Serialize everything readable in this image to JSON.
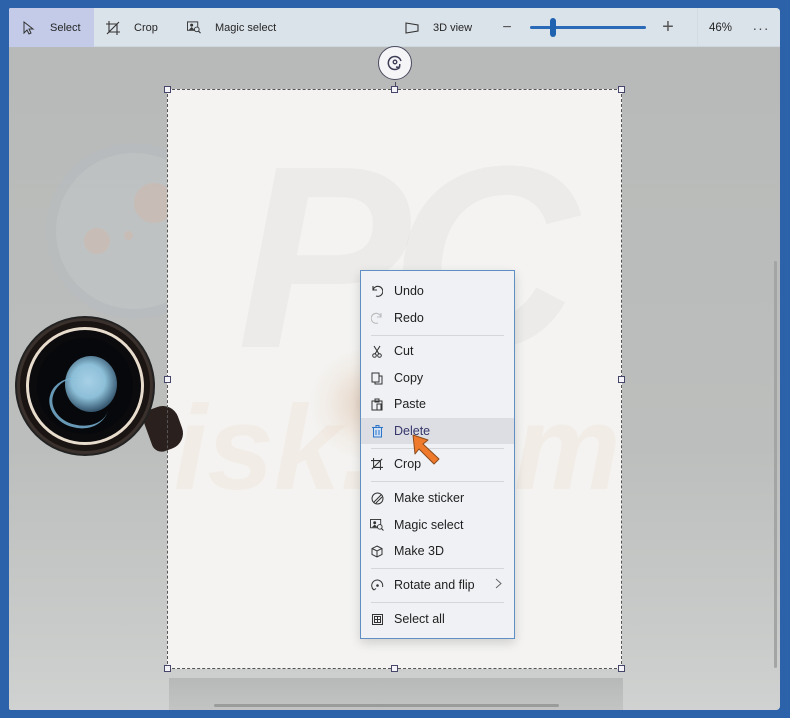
{
  "toolbar": {
    "select_label": "Select",
    "crop_label": "Crop",
    "magic_select_label": "Magic select",
    "view3d_label": "3D view",
    "zoom_out_label": "−",
    "zoom_in_label": "+",
    "zoom_level": "46%",
    "zoom_fraction": 0.2,
    "more_label": "···"
  },
  "context_menu": {
    "items": [
      {
        "label": "Undo",
        "icon": "undo-icon",
        "enabled": true
      },
      {
        "label": "Redo",
        "icon": "redo-icon",
        "enabled": false
      },
      {
        "label": "Cut",
        "icon": "cut-icon",
        "enabled": true
      },
      {
        "label": "Copy",
        "icon": "copy-icon",
        "enabled": true
      },
      {
        "label": "Paste",
        "icon": "paste-icon",
        "enabled": true
      },
      {
        "label": "Delete",
        "icon": "delete-icon",
        "enabled": true,
        "highlighted": true
      },
      {
        "label": "Crop",
        "icon": "crop-icon",
        "enabled": true
      },
      {
        "label": "Make sticker",
        "icon": "sticker-icon",
        "enabled": true
      },
      {
        "label": "Magic select",
        "icon": "magic-select-icon",
        "enabled": true
      },
      {
        "label": "Make 3D",
        "icon": "cube-icon",
        "enabled": true
      },
      {
        "label": "Rotate and flip",
        "icon": "rotate-icon",
        "enabled": true,
        "submenu": true
      },
      {
        "label": "Select all",
        "icon": "select-all-icon",
        "enabled": true
      }
    ]
  },
  "colors": {
    "accent": "#2a6ab6",
    "window_border": "#2b62a9",
    "highlight_text": "#36366a",
    "pointer": "#ef7a2c"
  }
}
